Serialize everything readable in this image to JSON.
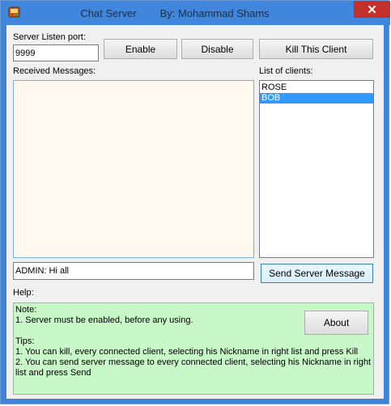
{
  "window": {
    "title": "Chat Server",
    "subtitle": "By: Mohammad Shams",
    "title_combined": "Chat Server        By: Mohammad Shams",
    "close_glyph": "✕"
  },
  "server": {
    "port_label": "Server Listen port:",
    "port_value": "9999",
    "enable_label": "Enable",
    "disable_label": "Disable",
    "kill_label": "Kill This Client"
  },
  "messages": {
    "label": "Received Messages:"
  },
  "clients": {
    "label": "List of clients:",
    "items": [
      {
        "name": "ROSE",
        "selected": false
      },
      {
        "name": "BOB",
        "selected": true
      }
    ]
  },
  "send": {
    "message_value": "ADMIN: Hi all",
    "button_label": "Send Server Message"
  },
  "help": {
    "label": "Help:",
    "lines": [
      "Note:",
      "1. Server must be enabled, before any using.",
      "",
      "Tips:",
      "1. You can kill, every connected client, selecting his Nickname in right list and press Kill",
      "2. You can send server message to every connected client, selecting his Nickname in right",
      "list and press Send"
    ],
    "about_label": "About"
  },
  "colors": {
    "titlebar": "#3f86dc",
    "close": "#c4302b",
    "selection": "#3399ff",
    "help_bg": "#c8f8c8",
    "message_bg": "#fdf9ee"
  }
}
